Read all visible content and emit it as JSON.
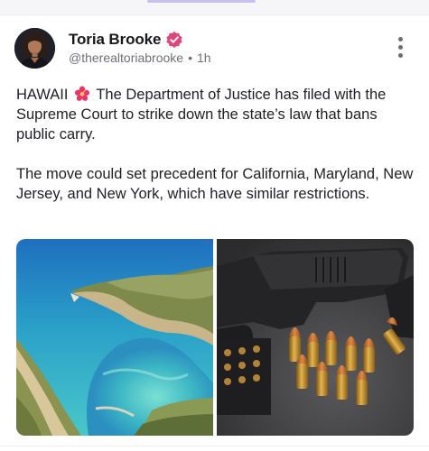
{
  "post": {
    "author_name": "Toria Brooke",
    "handle": "@therealtoriabrooke",
    "separator": "•",
    "time": "1h",
    "paragraph1_prefix": "HAWAII",
    "paragraph1_rest": "The Department of Justice has filed with the Supreme Court to strike down the state’s law that bans public carry.",
    "paragraph2": "The move could set precedent for California, Maryland, New Jersey, and New York, which have similar restrictions."
  },
  "icons": {
    "verified": "verified-badge-icon",
    "emoji": "hibiscus-icon",
    "menu": "more-vertical-icon"
  },
  "colors": {
    "verified_badge": "#e0447b",
    "accent_handle_bar": "#c9c0ef",
    "text_primary": "#1e1e24",
    "text_secondary": "#6f6f79"
  }
}
